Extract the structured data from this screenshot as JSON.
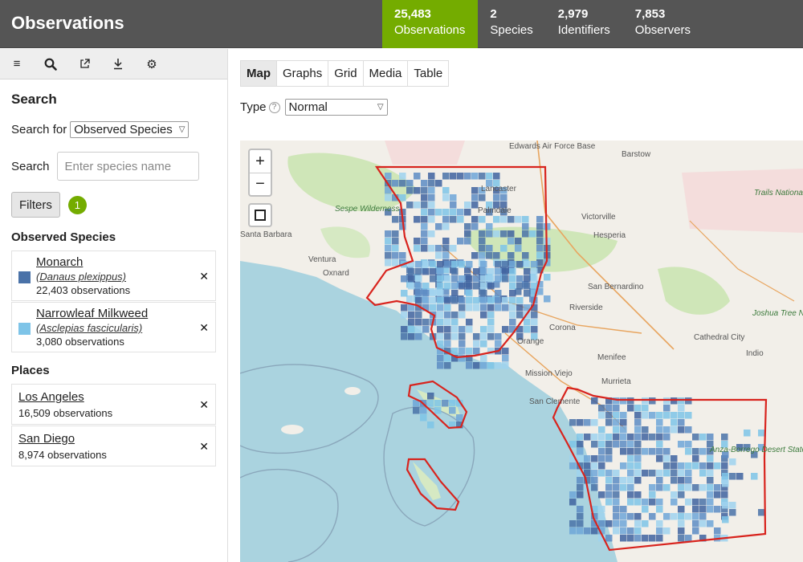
{
  "header": {
    "title": "Observations",
    "stats": [
      {
        "value": "25,483",
        "label": "Observations",
        "active": true
      },
      {
        "value": "2",
        "label": "Species",
        "active": false
      },
      {
        "value": "2,979",
        "label": "Identifiers",
        "active": false
      },
      {
        "value": "7,853",
        "label": "Observers",
        "active": false
      }
    ]
  },
  "toolbar": {
    "icons": [
      "menu-icon",
      "search-icon",
      "external-link-icon",
      "download-icon",
      "gear-icon"
    ],
    "glyphs": [
      "≡",
      "🔍︎",
      "↗",
      "⤓",
      "⚙"
    ]
  },
  "sidebar": {
    "search_heading": "Search",
    "search_for_label": "Search for",
    "search_for_value": "Observed Species",
    "search_label": "Search",
    "search_placeholder": "Enter species name",
    "filters_label": "Filters",
    "filters_count": "1",
    "observed_species_heading": "Observed Species",
    "species": [
      {
        "name": "Monarch",
        "scientific": "(Danaus plexippus)",
        "count": "22,403 observations",
        "color": "#4a72a8"
      },
      {
        "name": "Narrowleaf Milkweed",
        "scientific": "(Asclepias fascicularis)",
        "count": "3,080 observations",
        "color": "#7ec4e8"
      }
    ],
    "places_heading": "Places",
    "places": [
      {
        "name": "Los Angeles",
        "count": "16,509 observations"
      },
      {
        "name": "San Diego",
        "count": "8,974 observations"
      }
    ],
    "remove_glyph": "✕"
  },
  "main": {
    "tabs": [
      {
        "label": "Map",
        "active": true
      },
      {
        "label": "Graphs",
        "active": false
      },
      {
        "label": "Grid",
        "active": false
      },
      {
        "label": "Media",
        "active": false
      },
      {
        "label": "Table",
        "active": false
      }
    ],
    "type_label": "Type",
    "type_help": "?",
    "type_value": "Normal",
    "map": {
      "zoom_in": "+",
      "zoom_out": "−",
      "labels": [
        {
          "text": "Edwards Air Force Base",
          "kind": "place"
        },
        {
          "text": "Barstow",
          "kind": "place"
        },
        {
          "text": "Lancaster",
          "kind": "place"
        },
        {
          "text": "Palmdale",
          "kind": "place"
        },
        {
          "text": "Sespe Wilderness",
          "kind": "park"
        },
        {
          "text": "Victorville",
          "kind": "place"
        },
        {
          "text": "Hesperia",
          "kind": "place"
        },
        {
          "text": "Santa Barbara",
          "kind": "place"
        },
        {
          "text": "Ventura",
          "kind": "place"
        },
        {
          "text": "Oxnard",
          "kind": "place"
        },
        {
          "text": "San Bernardino",
          "kind": "place"
        },
        {
          "text": "Riverside",
          "kind": "place"
        },
        {
          "text": "Corona",
          "kind": "place"
        },
        {
          "text": "Orange",
          "kind": "place"
        },
        {
          "text": "Menifee",
          "kind": "place"
        },
        {
          "text": "Mission Viejo",
          "kind": "place"
        },
        {
          "text": "Murrieta",
          "kind": "place"
        },
        {
          "text": "San Clemente",
          "kind": "place"
        },
        {
          "text": "Cathedral City",
          "kind": "place"
        },
        {
          "text": "Indio",
          "kind": "place"
        },
        {
          "text": "Joshua Tree National",
          "kind": "park"
        },
        {
          "text": "Trails National Monument",
          "kind": "park"
        },
        {
          "text": "Anza-Borrego Desert State Park",
          "kind": "park"
        }
      ]
    }
  }
}
